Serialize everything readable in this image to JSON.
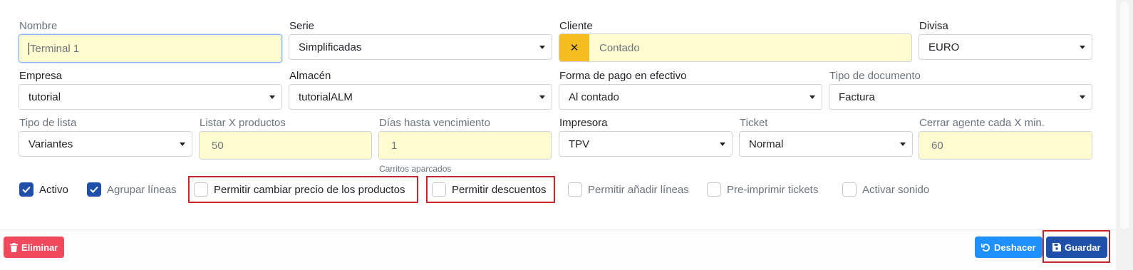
{
  "form": {
    "row1": {
      "nombre": {
        "label": "Nombre",
        "placeholder": "Terminal 1"
      },
      "serie": {
        "label": "Serie",
        "value": "Simplificadas"
      },
      "cliente": {
        "label": "Cliente",
        "placeholder": "Contado",
        "clear_glyph": "✕"
      },
      "divisa": {
        "label": "Divisa",
        "value": "EURO"
      }
    },
    "row2": {
      "empresa": {
        "label": "Empresa",
        "value": "tutorial"
      },
      "almacen": {
        "label": "Almacén",
        "value": "tutorialALM"
      },
      "forma_pago": {
        "label": "Forma de pago en efectivo",
        "value": "Al contado"
      },
      "tipo_documento": {
        "label": "Tipo de documento",
        "value": "Factura"
      }
    },
    "row3": {
      "tipo_lista": {
        "label": "Tipo de lista",
        "value": "Variantes"
      },
      "listar": {
        "label": "Listar X productos",
        "value": "50"
      },
      "dias": {
        "label": "Días hasta vencimiento",
        "value": "1",
        "hint": "Carritos aparcados"
      },
      "impresora": {
        "label": "Impresora",
        "value": "TPV"
      },
      "ticket": {
        "label": "Ticket",
        "value": "Normal"
      },
      "cerrar": {
        "label": "Cerrar agente cada X min.",
        "value": "60"
      }
    },
    "checkboxes": [
      {
        "label": "Activo",
        "checked": true
      },
      {
        "label": "Agrupar líneas",
        "checked": true
      },
      {
        "label": "Permitir cambiar precio de los productos",
        "checked": false
      },
      {
        "label": "Permitir descuentos",
        "checked": false
      },
      {
        "label": "Permitir añadir líneas",
        "checked": false
      },
      {
        "label": "Pre-imprimir tickets",
        "checked": false
      },
      {
        "label": "Activar sonido",
        "checked": false
      }
    ]
  },
  "footer": {
    "delete_label": "Eliminar",
    "undo_label": "Deshacer",
    "save_label": "Guardar"
  },
  "colors": {
    "accent_blue": "#1f4fa8",
    "delete_red": "#f0485d",
    "undo_blue": "#1e90ff",
    "save_navy": "#1f4fa8",
    "highlight_red": "#c7252c",
    "input_yellow": "#fffdd0",
    "clear_yellow": "#f5bd1f"
  }
}
